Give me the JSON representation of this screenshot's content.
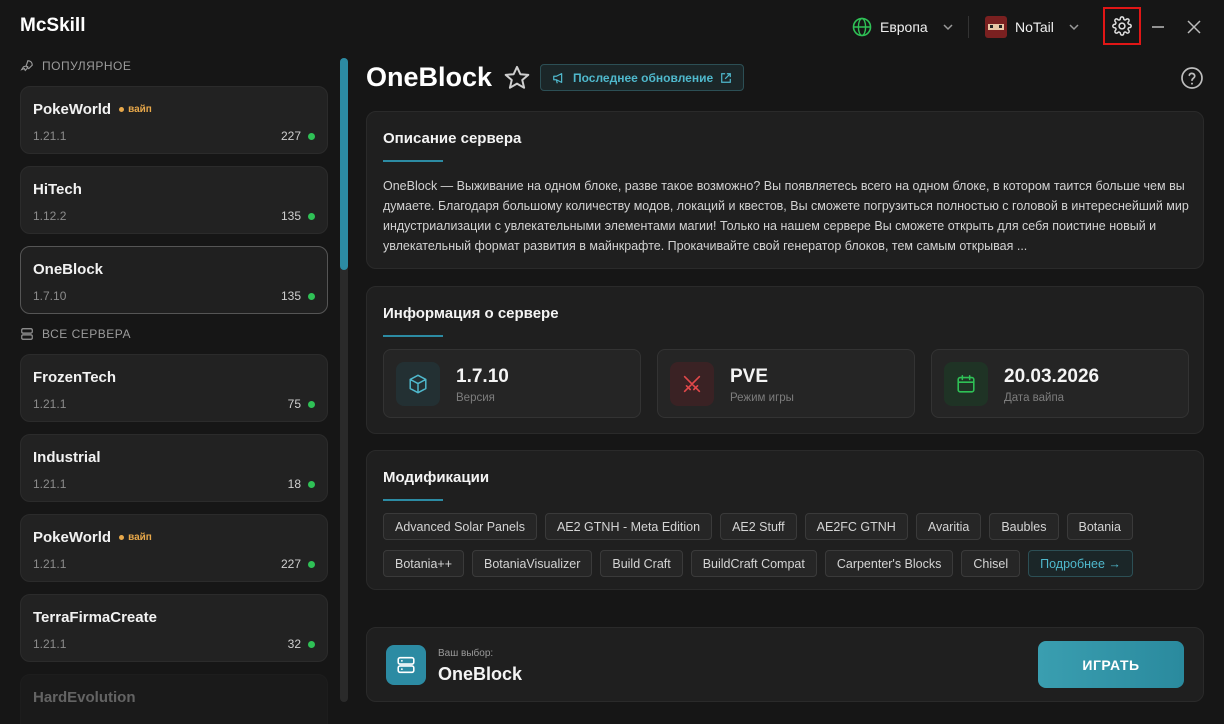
{
  "app": {
    "title": "McSkill"
  },
  "titlebar": {
    "region": "Европа",
    "username": "NoTail"
  },
  "sidebar": {
    "popular_label": "ПОПУЛЯРНОЕ",
    "all_label": "ВСЕ СЕРВЕРА",
    "popular": [
      {
        "name": "PokeWorld",
        "wipe": "вайп",
        "version": "1.21.1",
        "online": "227"
      },
      {
        "name": "HiTech",
        "wipe": "",
        "version": "1.12.2",
        "online": "135"
      },
      {
        "name": "OneBlock",
        "wipe": "",
        "version": "1.7.10",
        "online": "135"
      }
    ],
    "all": [
      {
        "name": "FrozenTech",
        "wipe": "",
        "version": "1.21.1",
        "online": "75"
      },
      {
        "name": "Industrial",
        "wipe": "",
        "version": "1.21.1",
        "online": "18"
      },
      {
        "name": "PokeWorld",
        "wipe": "вайп",
        "version": "1.21.1",
        "online": "227"
      },
      {
        "name": "TerraFirmaCreate",
        "wipe": "",
        "version": "1.21.1",
        "online": "32"
      },
      {
        "name": "HardEvolution",
        "wipe": "",
        "version": "",
        "online": ""
      }
    ]
  },
  "main": {
    "server_name": "OneBlock",
    "update_label": "Последнее обновление",
    "description": {
      "title": "Описание сервера",
      "text": "OneBlock  — Выживание на одном блоке, разве такое возможно? Вы появляетесь всего на одном блоке, в котором таится больше чем вы думаете. Благодаря большому количеству модов, локаций и квестов, Вы сможете погрузиться полностью с головой в интереснейший мир индустриализации с увлекательными элементами магии! Только на нашем сервере Вы сможете открыть для себя поистине новый и увлекательный формат развития в майнкрафте. Прокачивайте свой генератор блоков, тем самым открывая ..."
    },
    "info": {
      "title": "Информация о сервере",
      "cards": [
        {
          "value": "1.7.10",
          "label": "Версия"
        },
        {
          "value": "PVE",
          "label": "Режим игры"
        },
        {
          "value": "20.03.2026",
          "label": "Дата вайпа"
        }
      ]
    },
    "mods": {
      "title": "Модификации",
      "items": [
        "Advanced Solar Panels",
        "AE2 GTNH - Meta Edition",
        "AE2 Stuff",
        "AE2FC GTNH",
        "Avaritia",
        "Baubles",
        "Botania",
        "Botania++",
        "BotaniaVisualizer",
        "Build Craft",
        "BuildCraft Compat",
        "Carpenter's Blocks",
        "Chisel"
      ],
      "more_label": "Подробнее →"
    },
    "footer": {
      "choice_label": "Ваш выбор:",
      "choice_name": "OneBlock",
      "play_label": "ИГРАТЬ"
    }
  },
  "colors": {
    "accent": "#2c8ba3",
    "online": "#2fc156",
    "wipe": "#e8a84a"
  }
}
